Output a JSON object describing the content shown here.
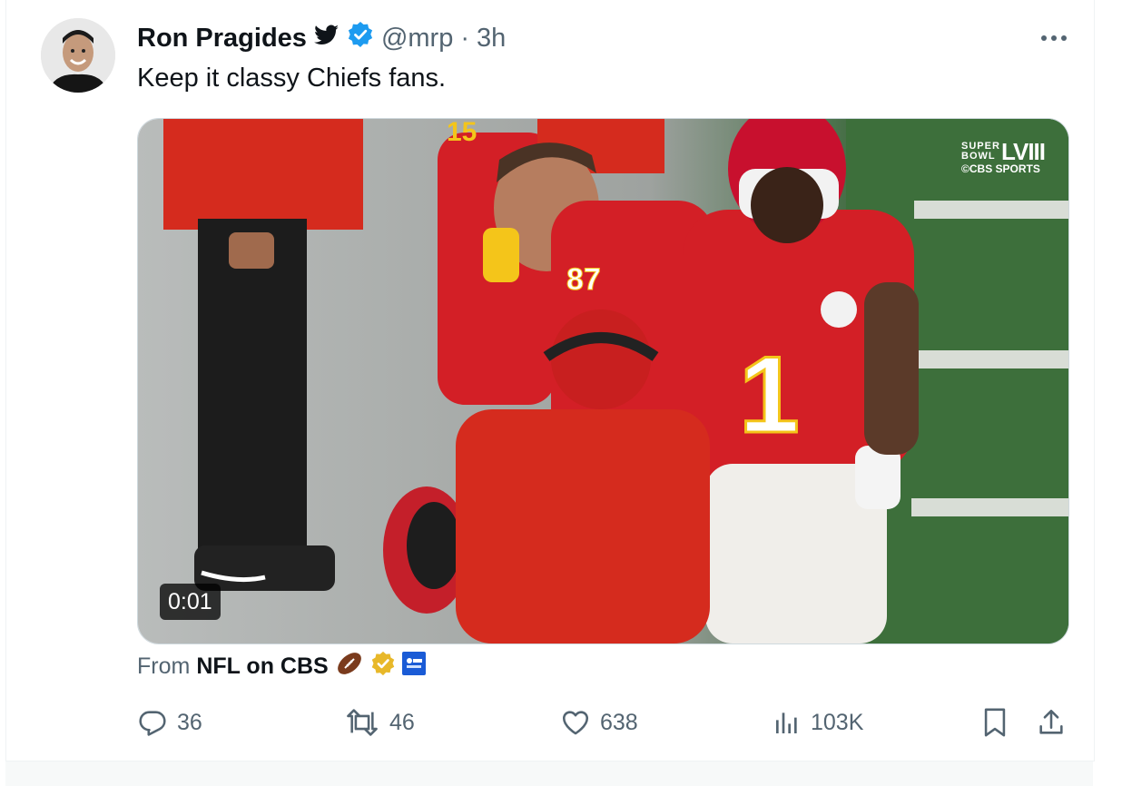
{
  "tweet": {
    "author_name": "Ron Pragides",
    "handle": "@mrp",
    "separator": "·",
    "time": "3h",
    "text": "Keep it classy Chiefs fans."
  },
  "media": {
    "video_time": "0:01",
    "overlay_logo": {
      "line1": "SUPER BOWL",
      "line2": "LVIII",
      "line3": "©CBS SPORTS"
    },
    "jersey_numbers": [
      "15",
      "87",
      "1"
    ]
  },
  "source": {
    "prefix": "From",
    "name": "NFL on CBS"
  },
  "actions": {
    "replies": "36",
    "retweets": "46",
    "likes": "638",
    "views": "103K"
  },
  "colors": {
    "verified_blue": "#1d9bf0",
    "text_primary": "#0f1419",
    "text_secondary": "#536471",
    "chiefs_red": "#e31837",
    "gold_badge": "#e8b829"
  }
}
